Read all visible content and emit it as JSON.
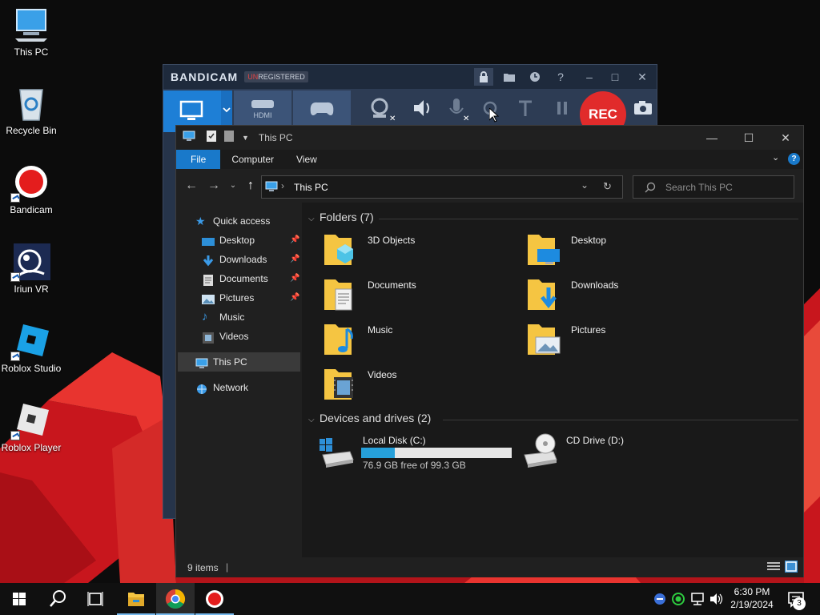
{
  "desktop": {
    "icons": [
      {
        "label": "This PC",
        "icon": "computer-icon"
      },
      {
        "label": "Recycle Bin",
        "icon": "recycle-bin-icon"
      },
      {
        "label": "Bandicam",
        "icon": "bandicam-icon"
      },
      {
        "label": "Iriun VR",
        "icon": "iriun-vr-icon"
      },
      {
        "label": "Roblox Studio",
        "icon": "roblox-studio-icon"
      },
      {
        "label": "Roblox Player",
        "icon": "roblox-player-icon"
      }
    ]
  },
  "bandicam": {
    "logo": "BANDICAM",
    "unregistered_prefix": "UN",
    "unregistered_rest": "REGISTERED",
    "rec_label": "REC",
    "hdmi_label": "HDMI"
  },
  "explorer": {
    "title": "This PC",
    "ribbon_tabs": [
      "File",
      "Computer",
      "View"
    ],
    "address": "This PC",
    "search_placeholder": "Search This PC",
    "nav": {
      "quick_access": "Quick access",
      "items": [
        "Desktop",
        "Downloads",
        "Documents",
        "Pictures",
        "Music",
        "Videos"
      ],
      "this_pc": "This PC",
      "network": "Network"
    },
    "folders_header": "Folders (7)",
    "folders": [
      "3D Objects",
      "Desktop",
      "Documents",
      "Downloads",
      "Music",
      "Pictures",
      "Videos"
    ],
    "drives_header": "Devices and drives (2)",
    "drives": [
      {
        "name": "Local Disk (C:)",
        "free_text": "76.9 GB free of 99.3 GB",
        "used_fraction": 0.226
      },
      {
        "name": "CD Drive (D:)"
      }
    ],
    "status_items": "9 items"
  },
  "taskbar": {
    "time": "6:30 PM",
    "date": "2/19/2024",
    "notification_count": "3"
  },
  "colors": {
    "accent": "#1979ca",
    "rec_red": "#e12b2b",
    "folder_yellow": "#f5c542"
  }
}
